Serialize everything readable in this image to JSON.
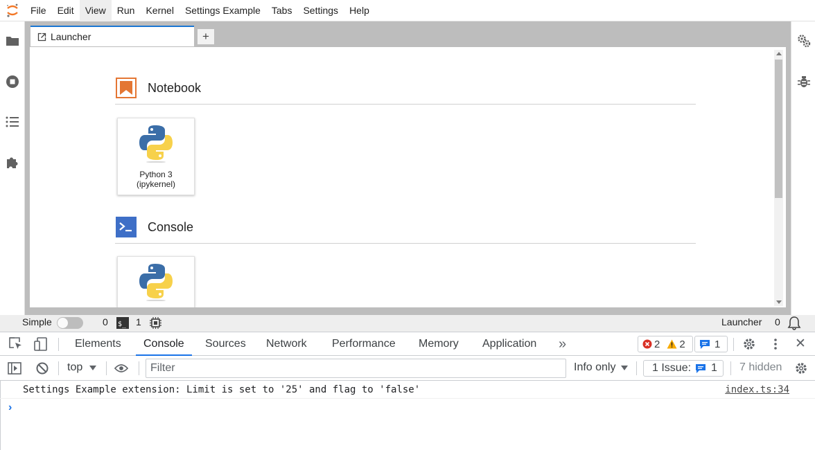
{
  "menubar": {
    "items": [
      "File",
      "Edit",
      "View",
      "Run",
      "Kernel",
      "Settings Example",
      "Tabs",
      "Settings",
      "Help"
    ],
    "active": "View",
    "logo_icon": "jupyter-logo-icon"
  },
  "left_sidebar": {
    "icons": [
      "folder-icon",
      "stop-circle-icon",
      "list-icon",
      "puzzle-icon"
    ]
  },
  "right_sidebar": {
    "icons": [
      "property-inspector-gears-icon",
      "debugger-bug-icon"
    ]
  },
  "tabs": {
    "items": [
      {
        "label": "Launcher",
        "icon": "launcher-icon"
      }
    ],
    "add_label": "+"
  },
  "launcher": {
    "sections": [
      {
        "title": "Notebook",
        "icon": "notebook-icon",
        "icon_color": "#e47633",
        "cards": [
          {
            "label_line1": "Python 3",
            "label_line2": "(ipykernel)"
          }
        ]
      },
      {
        "title": "Console",
        "icon": "console-icon",
        "icon_color": "#3e6fc7",
        "cards": [
          {
            "label_line1": "",
            "label_line2": ""
          }
        ]
      }
    ]
  },
  "statusbar": {
    "simple_label": "Simple",
    "simple_mode_on": false,
    "terminals_count": "0",
    "kernels_count": "1",
    "active_label": "Launcher",
    "notifications_count": "0"
  },
  "devtools": {
    "tabs": [
      "Elements",
      "Console",
      "Sources",
      "Network",
      "Performance",
      "Memory",
      "Application"
    ],
    "active_tab": "Console",
    "more_label": "»",
    "errors": "2",
    "warnings": "2",
    "messages": "1",
    "close_label": "✕",
    "console_toolbar": {
      "context": "top",
      "filter_placeholder": "Filter",
      "levels": "Info only",
      "issues_label": "1 Issue:",
      "issues_count": "1",
      "hidden": "7 hidden"
    },
    "log": [
      {
        "message": "Settings Example extension: Limit is set to '25' and flag to 'false'",
        "source": "index.ts:34"
      }
    ],
    "prompt": "›"
  },
  "colors": {
    "accent_blue": "#1a73e8",
    "tab_border": "#1976d2",
    "error_red": "#d93025",
    "warning_yellow": "#f9ab00"
  }
}
